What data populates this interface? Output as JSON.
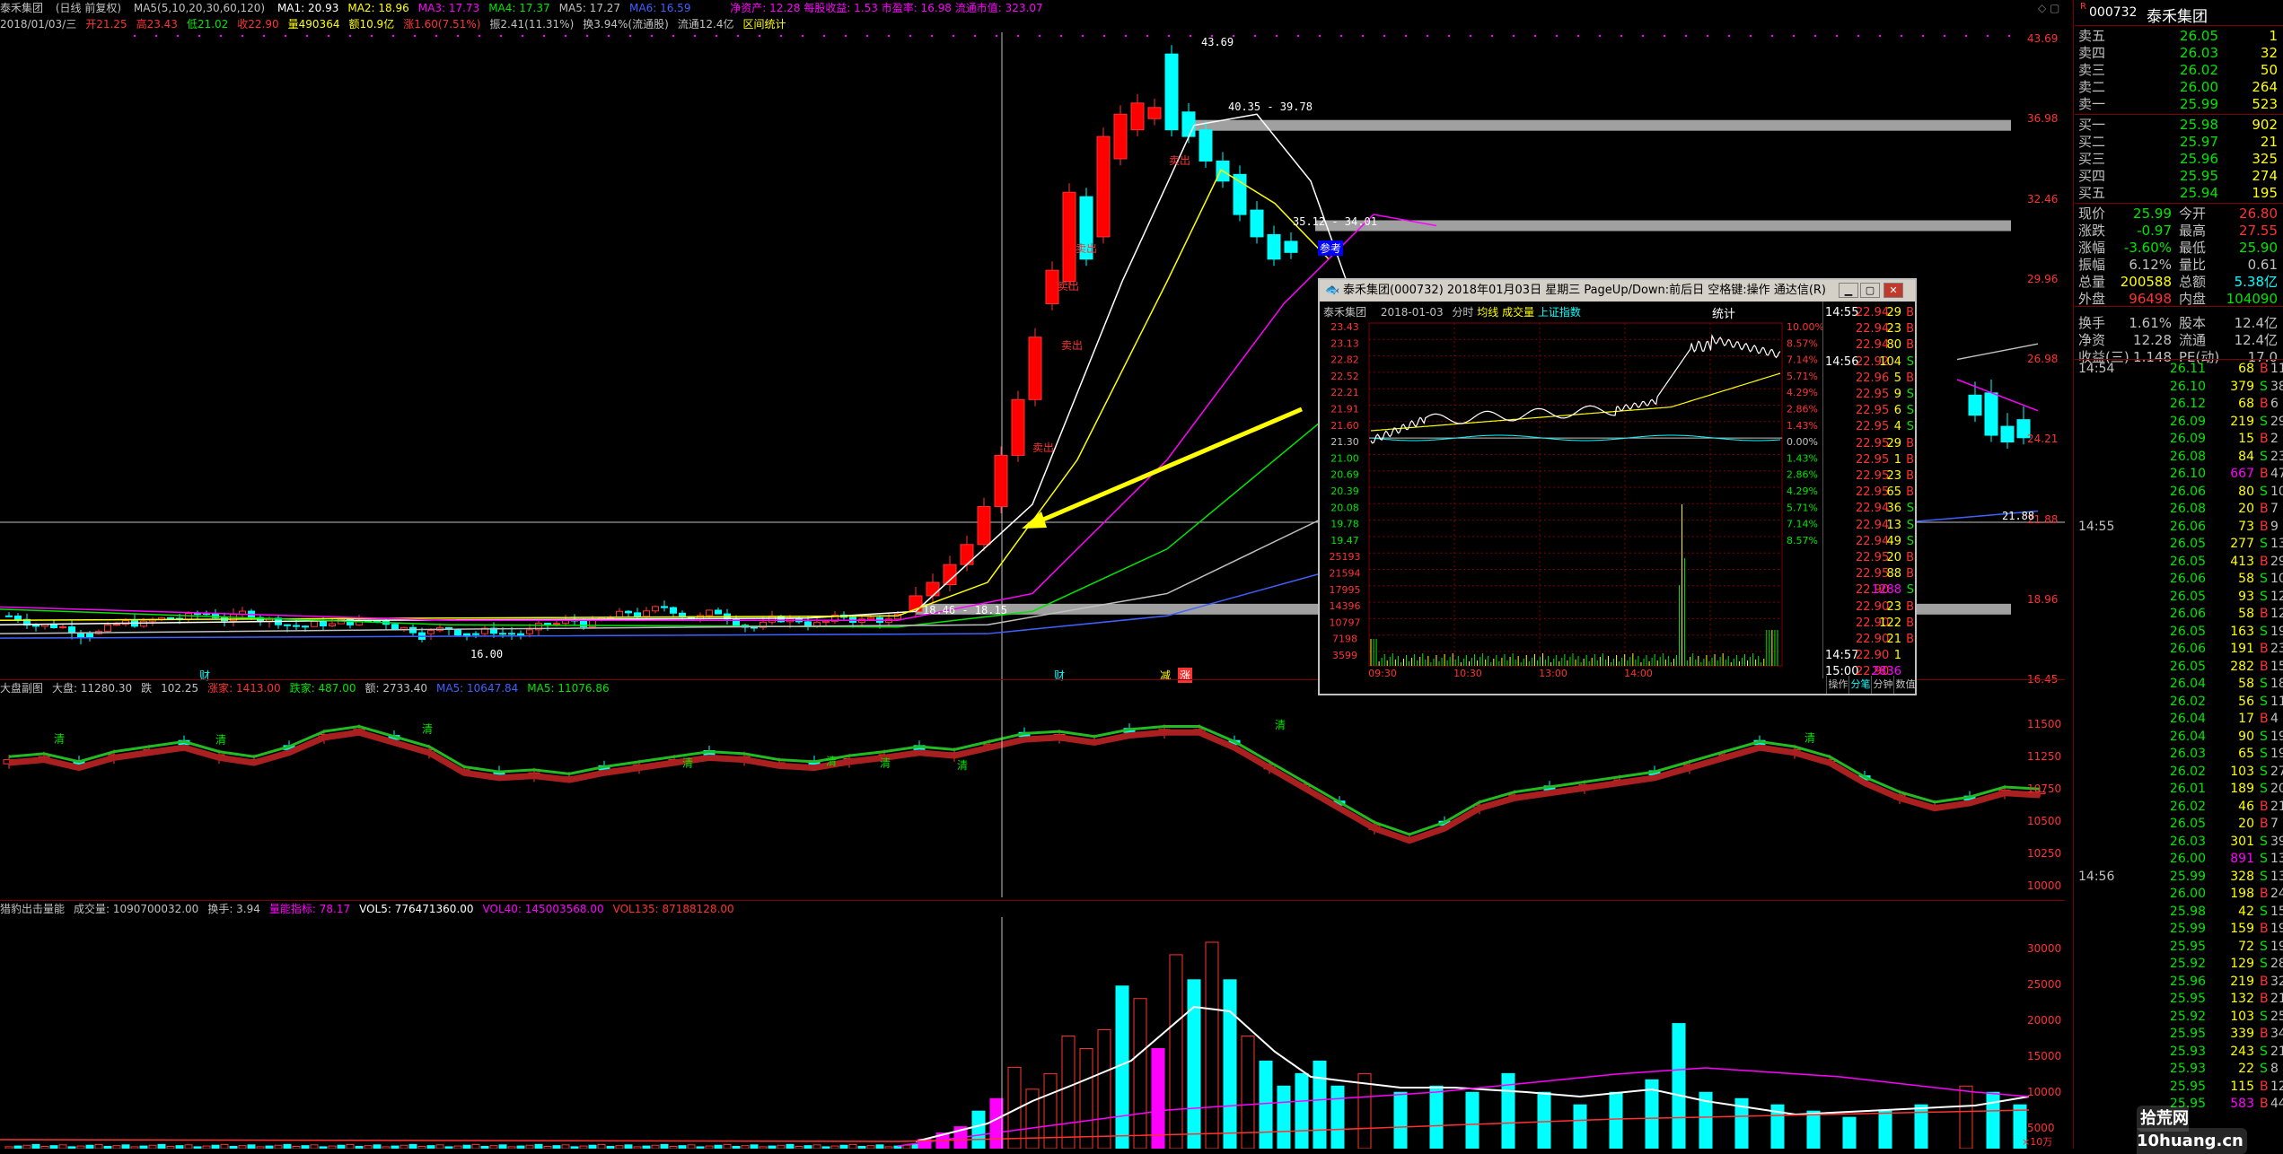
{
  "header": {
    "stock": "泰禾集团",
    "period": "(日线 前复权)",
    "ma_params": "MA5(5,10,20,30,60,120)",
    "ma": [
      {
        "label": "MA1:",
        "value": "20.93",
        "color": "#ffffff"
      },
      {
        "label": "MA2:",
        "value": "18.96",
        "color": "#ffff00"
      },
      {
        "label": "MA3:",
        "value": "17.73",
        "color": "#ff00ff"
      },
      {
        "label": "MA4:",
        "value": "17.37",
        "color": "#00e600"
      },
      {
        "label": "MA5:",
        "value": "17.27",
        "color": "#c0c0c0"
      },
      {
        "label": "MA6:",
        "value": "16.59",
        "color": "#4060ff"
      }
    ],
    "fin": "净资产: 12.28 每股收益: 1.53 市盈率: 16.98 流通市值: 323.07",
    "info": [
      {
        "text": "2018/01/03/三",
        "color": "#c0c0c0"
      },
      {
        "text": "开21.25",
        "color": "#ff3232"
      },
      {
        "text": "高23.43",
        "color": "#ff3232"
      },
      {
        "text": "低21.02",
        "color": "#00e600"
      },
      {
        "text": "收22.90",
        "color": "#ff3232"
      },
      {
        "text": "量490364",
        "color": "#ffff00"
      },
      {
        "text": "额10.9亿",
        "color": "#ffff00"
      },
      {
        "text": "涨1.60(7.51%)",
        "color": "#ff3232"
      },
      {
        "text": "振2.41(11.31%)",
        "color": "#c0c0c0"
      },
      {
        "text": "换3.94%(流通股)",
        "color": "#c0c0c0"
      },
      {
        "text": "流通12.4亿",
        "color": "#c0c0c0"
      },
      {
        "text": "区间统计",
        "color": "#ffff00"
      }
    ]
  },
  "main_axis": [
    "43.69",
    "36.98",
    "32.46",
    "29.96",
    "26.98",
    "24.21",
    "21.88",
    "18.96",
    "16.45"
  ],
  "annotations": {
    "high": "43.69",
    "box1": "40.35 - 39.78",
    "box2": "35.12 - 34.01",
    "box3": "18.46 - 18.15",
    "low": "16.00",
    "crosshair_price": "21.88",
    "sell1": "卖出",
    "sell2": "卖出",
    "sell3": "卖出",
    "sell4": "卖出",
    "sell5": "卖出",
    "ref": "参考",
    "xjd": "减",
    "zhang": "涨",
    "cai": "财"
  },
  "index_panel": {
    "title": "大盘副图",
    "items": [
      {
        "text": "大盘: 11280.30",
        "color": "#c0c0c0"
      },
      {
        "text": "跌",
        "color": "#c0c0c0"
      },
      {
        "text": "102.25",
        "color": "#c0c0c0"
      },
      {
        "text": "涨家: 1413.00",
        "color": "#ff3232"
      },
      {
        "text": "跌家: 487.00",
        "color": "#00e600"
      },
      {
        "text": "额: 2733.40",
        "color": "#c0c0c0"
      },
      {
        "text": "MA5: 10647.84",
        "color": "#4060ff"
      },
      {
        "text": "MA5: 11076.86",
        "color": "#00e600"
      }
    ],
    "axis": [
      "11500",
      "11250",
      "10750",
      "10500",
      "10250",
      "10000"
    ],
    "green_label": "清"
  },
  "vol_panel": {
    "title": "猎豹出击量能",
    "items": [
      {
        "text": "成交量: 1090700032.00",
        "color": "#c0c0c0"
      },
      {
        "text": "换手: 3.94",
        "color": "#c0c0c0"
      },
      {
        "text": "量能指标: 78.17",
        "color": "#ff00ff"
      },
      {
        "text": "VOL5: 776471360.00",
        "color": "#ffffff"
      },
      {
        "text": "VOL40: 145003568.00",
        "color": "#ff00ff"
      },
      {
        "text": "VOL135: 87188128.00",
        "color": "#ff3232"
      }
    ],
    "axis": [
      "30000",
      "25000",
      "20000",
      "15000",
      "10000",
      "5000"
    ],
    "unit": "×10万"
  },
  "quote": {
    "code": "000732",
    "name": "泰禾集团",
    "asks": [
      {
        "label": "卖五",
        "price": "26.05",
        "vol": "1"
      },
      {
        "label": "卖四",
        "price": "26.03",
        "vol": "32"
      },
      {
        "label": "卖三",
        "price": "26.02",
        "vol": "50"
      },
      {
        "label": "卖二",
        "price": "26.00",
        "vol": "264"
      },
      {
        "label": "卖一",
        "price": "25.99",
        "vol": "523"
      }
    ],
    "bids": [
      {
        "label": "买一",
        "price": "25.98",
        "vol": "902"
      },
      {
        "label": "买二",
        "price": "25.97",
        "vol": "21"
      },
      {
        "label": "买三",
        "price": "25.96",
        "vol": "325"
      },
      {
        "label": "买四",
        "price": "25.95",
        "vol": "274"
      },
      {
        "label": "买五",
        "price": "25.94",
        "vol": "195"
      }
    ],
    "stats": [
      {
        "l": "现价",
        "v": "25.99",
        "m": "今开",
        "v2": "26.80"
      },
      {
        "l": "涨跌",
        "v": "-0.97",
        "m": "最高",
        "v2": "27.55"
      },
      {
        "l": "涨幅",
        "v": "-3.60%",
        "m": "最低",
        "v2": "25.90"
      },
      {
        "l": "振幅",
        "v": "6.12%",
        "m": "量比",
        "v2": "0.61"
      },
      {
        "l": "总量",
        "v": "200588",
        "m": "总额",
        "v2": "5.38亿"
      },
      {
        "l": "外盘",
        "v": "96498",
        "m": "内盘",
        "v2": "104090"
      },
      {
        "l": "换手",
        "v": "1.61%",
        "m": "股本",
        "v2": "12.4亿"
      },
      {
        "l": "净资",
        "v": "12.28",
        "m": "流通",
        "v2": "12.4亿"
      },
      {
        "l": "收益(三)",
        "v": "1.148",
        "m": "PE(动)",
        "v2": "17.0"
      }
    ],
    "ticks": [
      {
        "t": "14:54",
        "p": "26.11",
        "v": "68",
        "bs": "B",
        "n": "11"
      },
      {
        "t": "",
        "p": "26.10",
        "v": "379",
        "bs": "S",
        "n": "38"
      },
      {
        "t": "",
        "p": "26.12",
        "v": "68",
        "bs": "B",
        "n": "6"
      },
      {
        "t": "",
        "p": "26.09",
        "v": "219",
        "bs": "S",
        "n": "29"
      },
      {
        "t": "",
        "p": "26.09",
        "v": "15",
        "bs": "B",
        "n": "2"
      },
      {
        "t": "",
        "p": "26.08",
        "v": "84",
        "bs": "S",
        "n": "23"
      },
      {
        "t": "",
        "p": "26.10",
        "v": "667",
        "bs": "B",
        "n": "47"
      },
      {
        "t": "",
        "p": "26.06",
        "v": "80",
        "bs": "S",
        "n": "10"
      },
      {
        "t": "",
        "p": "26.08",
        "v": "20",
        "bs": "B",
        "n": "7"
      },
      {
        "t": "14:55",
        "p": "26.06",
        "v": "73",
        "bs": "B",
        "n": "9"
      },
      {
        "t": "",
        "p": "26.05",
        "v": "277",
        "bs": "S",
        "n": "13"
      },
      {
        "t": "",
        "p": "26.05",
        "v": "413",
        "bs": "B",
        "n": "29"
      },
      {
        "t": "",
        "p": "26.06",
        "v": "58",
        "bs": "S",
        "n": "10"
      },
      {
        "t": "",
        "p": "26.05",
        "v": "93",
        "bs": "S",
        "n": "12"
      },
      {
        "t": "",
        "p": "26.06",
        "v": "58",
        "bs": "B",
        "n": "12"
      },
      {
        "t": "",
        "p": "26.05",
        "v": "163",
        "bs": "S",
        "n": "19"
      },
      {
        "t": "",
        "p": "26.06",
        "v": "191",
        "bs": "B",
        "n": "23"
      },
      {
        "t": "",
        "p": "26.05",
        "v": "282",
        "bs": "B",
        "n": "15"
      },
      {
        "t": "",
        "p": "26.04",
        "v": "58",
        "bs": "S",
        "n": "18"
      },
      {
        "t": "",
        "p": "26.02",
        "v": "56",
        "bs": "S",
        "n": "11"
      },
      {
        "t": "",
        "p": "26.04",
        "v": "17",
        "bs": "B",
        "n": "4"
      },
      {
        "t": "",
        "p": "26.04",
        "v": "90",
        "bs": "S",
        "n": "19"
      },
      {
        "t": "",
        "p": "26.03",
        "v": "65",
        "bs": "S",
        "n": "19"
      },
      {
        "t": "",
        "p": "26.02",
        "v": "103",
        "bs": "S",
        "n": "27"
      },
      {
        "t": "",
        "p": "26.01",
        "v": "189",
        "bs": "S",
        "n": "20"
      },
      {
        "t": "",
        "p": "26.02",
        "v": "46",
        "bs": "B",
        "n": "21"
      },
      {
        "t": "",
        "p": "26.05",
        "v": "20",
        "bs": "B",
        "n": "7"
      },
      {
        "t": "",
        "p": "26.03",
        "v": "301",
        "bs": "S",
        "n": "39"
      },
      {
        "t": "",
        "p": "26.00",
        "v": "891",
        "bs": "S",
        "n": "133"
      },
      {
        "t": "14:56",
        "p": "25.99",
        "v": "328",
        "bs": "S",
        "n": "13"
      },
      {
        "t": "",
        "p": "26.00",
        "v": "198",
        "bs": "B",
        "n": "24"
      },
      {
        "t": "",
        "p": "25.98",
        "v": "42",
        "bs": "S",
        "n": "15"
      },
      {
        "t": "",
        "p": "25.99",
        "v": "159",
        "bs": "B",
        "n": "19"
      },
      {
        "t": "",
        "p": "25.95",
        "v": "72",
        "bs": "S",
        "n": "19"
      },
      {
        "t": "",
        "p": "25.92",
        "v": "129",
        "bs": "S",
        "n": "28"
      },
      {
        "t": "",
        "p": "25.96",
        "v": "219",
        "bs": "B",
        "n": "32"
      },
      {
        "t": "",
        "p": "25.95",
        "v": "132",
        "bs": "B",
        "n": "21"
      },
      {
        "t": "",
        "p": "25.92",
        "v": "103",
        "bs": "S",
        "n": "25"
      },
      {
        "t": "",
        "p": "25.95",
        "v": "339",
        "bs": "B",
        "n": "34"
      },
      {
        "t": "",
        "p": "25.93",
        "v": "243",
        "bs": "S",
        "n": "21"
      },
      {
        "t": "",
        "p": "25.93",
        "v": "22",
        "bs": "S",
        "n": "8"
      },
      {
        "t": "",
        "p": "25.95",
        "v": "115",
        "bs": "B",
        "n": "12"
      },
      {
        "t": "",
        "p": "25.95",
        "v": "583",
        "bs": "B",
        "n": "44"
      }
    ]
  },
  "popup": {
    "title": "泰禾集团(000732) 2018年01月03日 星期三 PageUp/Down:前后日 空格键:操作 通达信(R)",
    "subtitle_name": "泰禾集团",
    "subtitle_date": "2018-01-03",
    "subtitle_items": [
      {
        "text": "分时",
        "color": "#c0c0c0"
      },
      {
        "text": "均线",
        "color": "#ffff00"
      },
      {
        "text": "成交量",
        "color": "#ffff00"
      },
      {
        "text": "上证指数",
        "color": "#00ffff"
      }
    ],
    "stat_label": "统计",
    "left_axis": [
      "23.43",
      "23.13",
      "22.82",
      "22.52",
      "22.21",
      "21.91",
      "21.60",
      "21.30",
      "21.00",
      "20.69",
      "20.39",
      "20.08",
      "19.78",
      "19.47",
      "25193",
      "21594",
      "17995",
      "14396",
      "10797",
      "7198",
      "3599"
    ],
    "right_axis": [
      "10.00%",
      "8.57%",
      "7.14%",
      "5.71%",
      "4.29%",
      "2.86%",
      "1.43%",
      "0.00%",
      "1.43%",
      "2.86%",
      "4.29%",
      "5.71%",
      "7.14%",
      "8.57%"
    ],
    "time_axis": [
      "09:30",
      "10:30",
      "13:00",
      "14:00"
    ],
    "ticks": [
      {
        "t": "14:55",
        "p": "22.94",
        "v": "29",
        "bs": "B"
      },
      {
        "t": "",
        "p": "22.94",
        "v": "23",
        "bs": "B"
      },
      {
        "t": "",
        "p": "22.94",
        "v": "80",
        "bs": "B"
      },
      {
        "t": "14:56",
        "p": "22.92",
        "v": "104",
        "bs": "S"
      },
      {
        "t": "",
        "p": "22.96",
        "v": "5",
        "bs": "B"
      },
      {
        "t": "",
        "p": "22.95",
        "v": "9",
        "bs": "S"
      },
      {
        "t": "",
        "p": "22.95",
        "v": "6",
        "bs": "S"
      },
      {
        "t": "",
        "p": "22.95",
        "v": "4",
        "bs": "S"
      },
      {
        "t": "",
        "p": "22.95",
        "v": "29",
        "bs": "B"
      },
      {
        "t": "",
        "p": "22.95",
        "v": "1",
        "bs": "B"
      },
      {
        "t": "",
        "p": "22.95",
        "v": "23",
        "bs": "B"
      },
      {
        "t": "",
        "p": "22.95",
        "v": "65",
        "bs": "B"
      },
      {
        "t": "",
        "p": "22.94",
        "v": "36",
        "bs": "S"
      },
      {
        "t": "",
        "p": "22.94",
        "v": "13",
        "bs": "S"
      },
      {
        "t": "",
        "p": "22.94",
        "v": "49",
        "bs": "S"
      },
      {
        "t": "",
        "p": "22.95",
        "v": "20",
        "bs": "B"
      },
      {
        "t": "",
        "p": "22.95",
        "v": "88",
        "bs": "B"
      },
      {
        "t": "",
        "p": "22.90",
        "v": "1288",
        "bs": "S"
      },
      {
        "t": "",
        "p": "22.90",
        "v": "23",
        "bs": "B"
      },
      {
        "t": "",
        "p": "22.90",
        "v": "122",
        "bs": "B"
      },
      {
        "t": "",
        "p": "22.90",
        "v": "21",
        "bs": "B"
      },
      {
        "t": "14:57",
        "p": "22.90",
        "v": "1",
        "bs": ""
      },
      {
        "t": "15:00",
        "p": "22.90",
        "v": "2836",
        "bs": ""
      }
    ],
    "tabs": [
      "操作",
      "分笔",
      "分钟",
      "数值"
    ]
  },
  "watermark": "拾荒网 10huang.cn"
}
